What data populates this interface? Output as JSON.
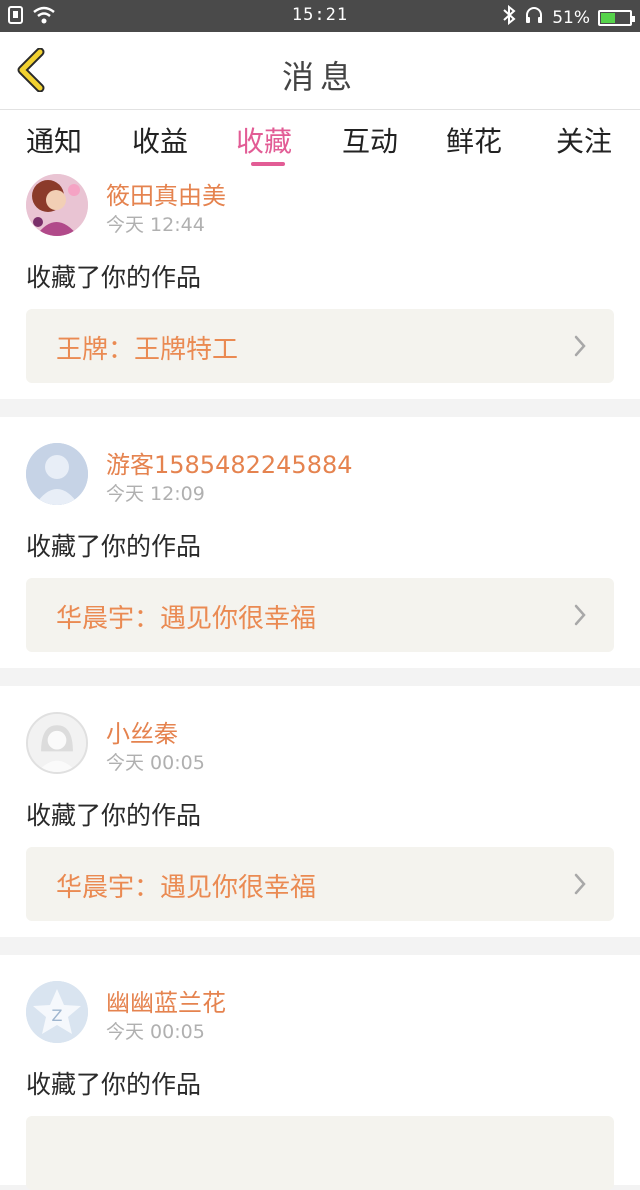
{
  "status_bar": {
    "time": "15:21",
    "battery_text": "51%",
    "battery_level": 0.51,
    "icons": [
      "sim-icon",
      "wifi-icon",
      "bluetooth-icon",
      "headset-icon",
      "battery-icon"
    ]
  },
  "header": {
    "title": "消息",
    "back_icon": "chevron-left-icon",
    "accent": "#f2d231"
  },
  "tabs": [
    {
      "label": "通知"
    },
    {
      "label": "收益"
    },
    {
      "label": "收藏"
    },
    {
      "label": "互动"
    },
    {
      "label": "鲜花"
    },
    {
      "label": "关注"
    }
  ],
  "active_tab_color": "#e25c95",
  "feed": [
    {
      "username": "筱田真由美",
      "time": "今天 12:44",
      "action": "收藏了你的作品",
      "work": "王牌：王牌特工"
    },
    {
      "username": "游客1585482245884",
      "time": "今天 12:09",
      "action": "收藏了你的作品",
      "work": "华晨宇：遇见你很幸福"
    },
    {
      "username": "小丝秦",
      "time": "今天 00:05",
      "action": "收藏了你的作品",
      "work": "华晨宇：遇见你很幸福"
    },
    {
      "username": "幽幽蓝兰花",
      "time": "今天 00:05",
      "action": "收藏了你的作品",
      "work": ""
    }
  ]
}
